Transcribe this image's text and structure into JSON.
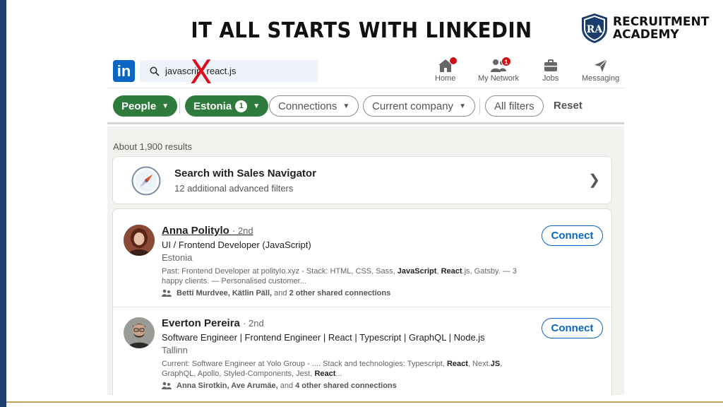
{
  "slide": {
    "title": "IT ALL STARTS WITH LINKEDIN",
    "brand_initials": "RA",
    "brand_line1": "RECRUITMENT",
    "brand_line2": "ACADEMY",
    "red_mark": "X"
  },
  "colors": {
    "linkedin_blue": "#0a66c2",
    "filter_green": "#2f7a3d",
    "badge_red": "#cc1016",
    "slide_navy": "#1a3d6e",
    "rule_gold": "#b8a35a"
  },
  "nav": {
    "logo": "in",
    "search_value": "javascript react.js",
    "items": [
      {
        "label": "Home",
        "icon": "home-icon",
        "badge": ""
      },
      {
        "label": "My Network",
        "icon": "network-icon",
        "badge": "1"
      },
      {
        "label": "Jobs",
        "icon": "briefcase-icon",
        "badge": ""
      },
      {
        "label": "Messaging",
        "icon": "messaging-icon",
        "badge": ""
      }
    ]
  },
  "filters": {
    "people": "People",
    "estonia": "Estonia",
    "estonia_count": "1",
    "connections": "Connections",
    "current_company": "Current company",
    "all_filters": "All filters",
    "reset": "Reset"
  },
  "results": {
    "count_text": "About 1,900 results",
    "sales_nav": {
      "title": "Search with Sales Navigator",
      "subtitle": "12 additional advanced filters",
      "icon": "compass-icon"
    },
    "people": [
      {
        "name": "Anna Politylo",
        "degree": "· 2nd",
        "headline": "UI / Frontend Developer (JavaScript)",
        "location": "Estonia",
        "snippet_a": "Past: Frontend Developer at polityIo.xyz - Stack: HTML, CSS, Sass, ",
        "snippet_b1": "JavaScript",
        "snippet_c": ", ",
        "snippet_b2": "React",
        "snippet_d": ".js, Gatsby. — 3 happy clients. — Personalised customer...",
        "shared_names": "Betti Murdvee, Kätlin Päll,",
        "shared_and": " and ",
        "shared_more": "2 other shared connections",
        "action": "Connect"
      },
      {
        "name": "Everton Pereira",
        "degree": "· 2nd",
        "headline": "Software Engineer | Frontend Engineer | React | Typescript | GraphQL | Node.js",
        "location": "Tallinn",
        "snippet_a": "Current: Software Engineer at Yolo Group - .... Stack and technologies: Typescript, ",
        "snippet_b1": "React",
        "snippet_c": ", Next.",
        "snippet_b2": "JS",
        "snippet_d": ", GraphQL, Apollo, Styled-Components, Jest, ",
        "snippet_e": "React",
        "snippet_f": "...",
        "shared_names": "Anna Sirotkin, Ave Arumäe,",
        "shared_and": " and ",
        "shared_more": "4 other shared connections",
        "action": "Connect"
      }
    ]
  }
}
